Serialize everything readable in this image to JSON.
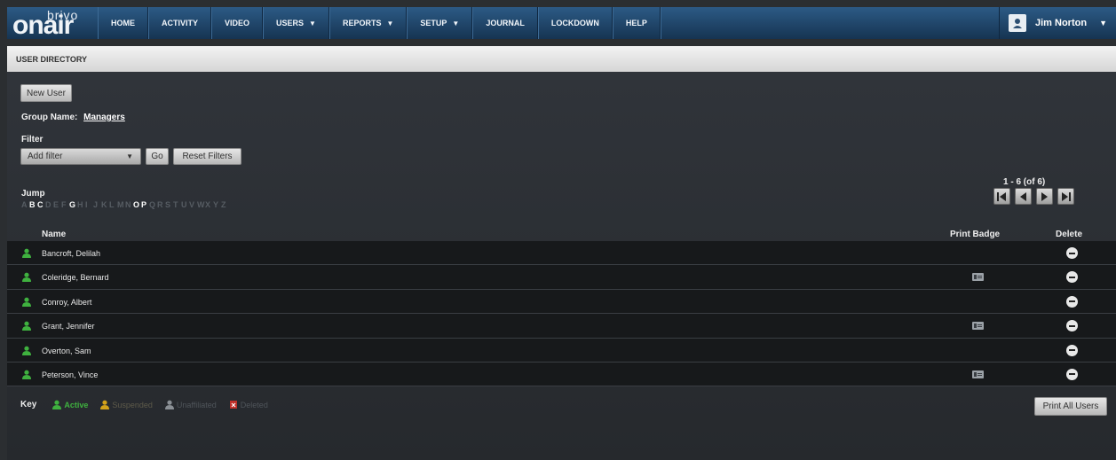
{
  "logo": {
    "top": "brivo",
    "bottom": "onair"
  },
  "nav": [
    {
      "label": "HOME",
      "dropdown": false
    },
    {
      "label": "ACTIVITY",
      "dropdown": false
    },
    {
      "label": "VIDEO",
      "dropdown": false
    },
    {
      "label": "USERS",
      "dropdown": true
    },
    {
      "label": "REPORTS",
      "dropdown": true
    },
    {
      "label": "SETUP",
      "dropdown": true
    },
    {
      "label": "JOURNAL",
      "dropdown": false
    },
    {
      "label": "LOCKDOWN",
      "dropdown": false
    },
    {
      "label": "HELP",
      "dropdown": false
    }
  ],
  "user": {
    "name": "Jim Norton",
    "icon": "user-avatar-icon"
  },
  "page": {
    "title": "USER DIRECTORY"
  },
  "actions": {
    "new_user": "New User",
    "print_all": "Print All Users"
  },
  "group": {
    "label": "Group Name:",
    "name": "Managers"
  },
  "filter": {
    "label": "Filter",
    "select_value": "Add filter",
    "go": "Go",
    "reset": "Reset Filters"
  },
  "jump": {
    "label": "Jump",
    "letters": [
      "A",
      "B",
      "C",
      "D",
      "E",
      "F",
      "G",
      "H",
      "I",
      "J",
      "K",
      "L",
      "M",
      "N",
      "O",
      "P",
      "Q",
      "R",
      "S",
      "T",
      "U",
      "V",
      "W",
      "X",
      "Y",
      "Z"
    ],
    "enabled": [
      "B",
      "C",
      "G",
      "O",
      "P"
    ]
  },
  "pagination": {
    "summary": "1 - 6 (of 6)"
  },
  "table": {
    "columns": {
      "name": "Name",
      "print_badge": "Print Badge",
      "delete": "Delete"
    },
    "rows": [
      {
        "name": "Bancroft, Delilah",
        "status": "active",
        "has_badge": false
      },
      {
        "name": "Coleridge, Bernard",
        "status": "active",
        "has_badge": true
      },
      {
        "name": "Conroy, Albert",
        "status": "active",
        "has_badge": false
      },
      {
        "name": "Grant, Jennifer",
        "status": "active",
        "has_badge": true
      },
      {
        "name": "Overton, Sam",
        "status": "active",
        "has_badge": false
      },
      {
        "name": "Peterson, Vince",
        "status": "active",
        "has_badge": true
      }
    ]
  },
  "key": {
    "label": "Key",
    "items": [
      {
        "label": "Active",
        "color": "#3fb13f"
      },
      {
        "label": "Suspended",
        "color": "#d4a21a"
      },
      {
        "label": "Unaffiliated",
        "color": "#8a8f95"
      },
      {
        "label": "Deleted",
        "color": "#c0302a"
      }
    ]
  },
  "colors": {
    "nav_bg": "#1e4670",
    "active_user": "#3fb13f",
    "row_bg": "#17191b"
  }
}
